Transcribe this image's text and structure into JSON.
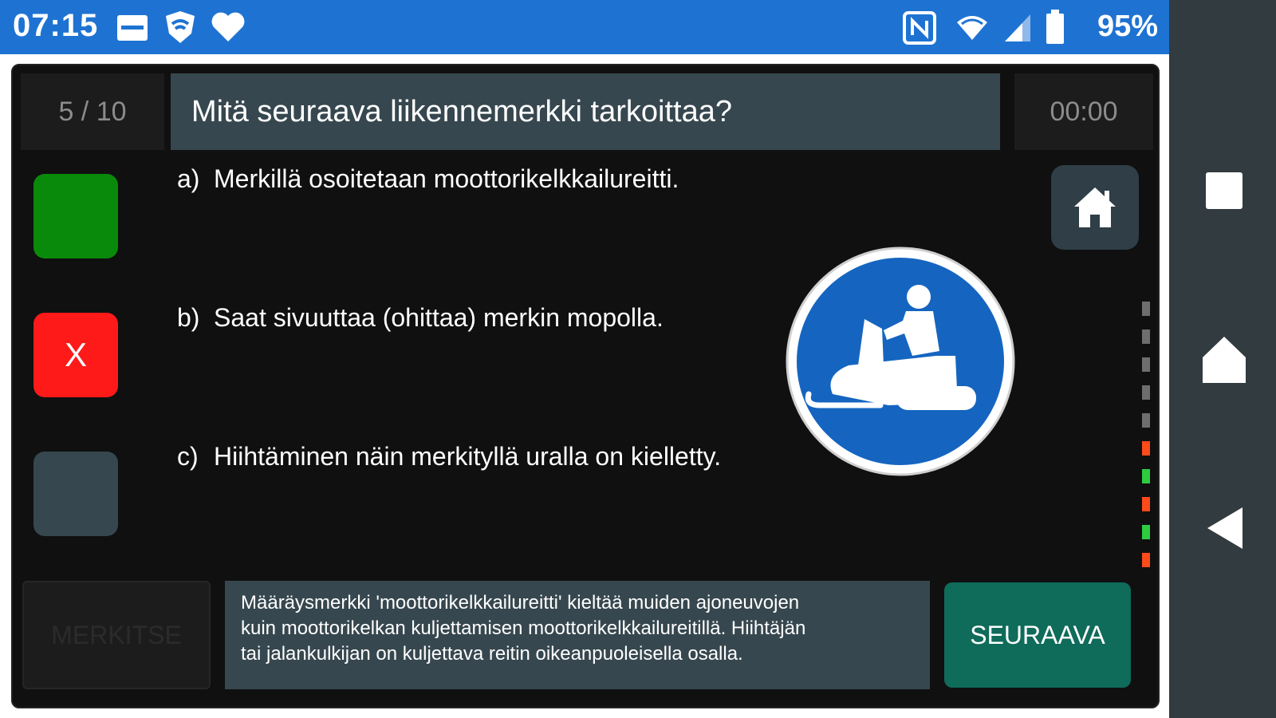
{
  "status_bar": {
    "time": "07:15",
    "battery_percent": "95%",
    "left_icons": [
      "notification-card-icon",
      "shield-wifi-icon",
      "heart-icon"
    ],
    "right_icons": [
      "nfc-icon",
      "wifi-icon",
      "cellular-signal-icon",
      "battery-icon"
    ],
    "background": "#1e73d2"
  },
  "quiz": {
    "counter": "5 / 10",
    "question": "Mitä seuraava liikennemerkki tarkoittaa?",
    "timer": "00:00",
    "answers": [
      {
        "letter": "a)",
        "text": "Merkillä osoitetaan moottorikelkkailureitti.",
        "state": "correct",
        "color": "#0a8a0a",
        "mark": ""
      },
      {
        "letter": "b)",
        "text": "Saat sivuuttaa (ohittaa) merkin mopolla.",
        "state": "wrong",
        "color": "#ff1a1a",
        "mark": "X"
      },
      {
        "letter": "c)",
        "text": "Hiihtäminen näin merkityllä uralla on kielletty.",
        "state": "unselected",
        "color": "#37474f",
        "mark": ""
      }
    ],
    "sign": {
      "icon": "snowmobile-sign-icon",
      "color": "#1565c0"
    },
    "progress": [
      "pending",
      "pending",
      "pending",
      "pending",
      "pending",
      "wrong",
      "correct",
      "wrong",
      "correct",
      "wrong"
    ],
    "progress_colors": {
      "pending": "#6e6e6e",
      "correct": "#2ecc40",
      "wrong": "#ff4a1a"
    }
  },
  "footer": {
    "mark_label": "MERKITSE",
    "explanation_lines": [
      "Määräysmerkki 'moottorikelkkailureitti' kieltää muiden ajoneuvojen",
      "kuin moottorikelkan kuljettamisen moottorikelkkailureitillä. Hiihtäjän",
      "tai jalankulkijan on kuljettava reitin oikeanpuoleisella osalla."
    ],
    "next_label": "SEURAAVA"
  },
  "nav_bar": {
    "buttons": [
      "recents-icon",
      "home-icon",
      "back-icon"
    ]
  }
}
